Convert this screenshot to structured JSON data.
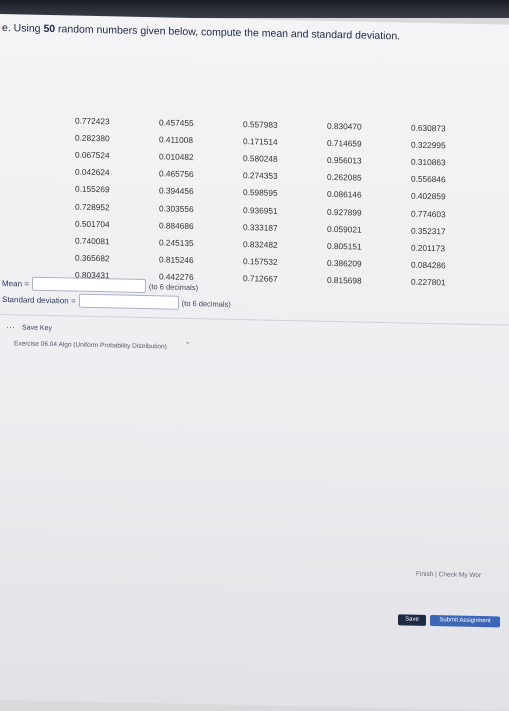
{
  "instruction": {
    "prefix": "e. Using ",
    "count": "50",
    "suffix": " random numbers given below, compute the mean and standard deviation."
  },
  "table": {
    "rows": [
      [
        "0.772423",
        "0.457455",
        "0.557983",
        "0.830470",
        "0.630873"
      ],
      [
        "0.282380",
        "0.411008",
        "0.171514",
        "0.714659",
        "0.322995"
      ],
      [
        "0.067524",
        "0.010482",
        "0.580248",
        "0.956013",
        "0.310863"
      ],
      [
        "0.042624",
        "0.465756",
        "0.274353",
        "0.262085",
        "0.556846"
      ],
      [
        "0.155269",
        "0.394456",
        "0.598595",
        "0.086146",
        "0.402859"
      ],
      [
        "0.728952",
        "0.303556",
        "0.936951",
        "0.927899",
        "0.774603"
      ],
      [
        "0.501704",
        "0.884686",
        "0.333187",
        "0.059021",
        "0.352317"
      ],
      [
        "0.740081",
        "0.245135",
        "0.832482",
        "0.805151",
        "0.201173"
      ],
      [
        "0.365682",
        "0.815246",
        "0.157532",
        "0.386209",
        "0.084286"
      ],
      [
        "0.803431",
        "0.442276",
        "0.712667",
        "0.815698",
        "0.227801"
      ]
    ]
  },
  "mean": {
    "label": "Mean =",
    "note": "(to 6 decimals)"
  },
  "sd": {
    "label": "Standard deviation =",
    "note": "(to 6 decimals)"
  },
  "footer": {
    "save_key": "Save Key",
    "exercise_link": "Exercise 06.04 Algo (Uniform Probability Distribution)",
    "finish": "Finish | Check My Wor",
    "save_button": "Save",
    "submit_button": "Submit Assignment"
  }
}
